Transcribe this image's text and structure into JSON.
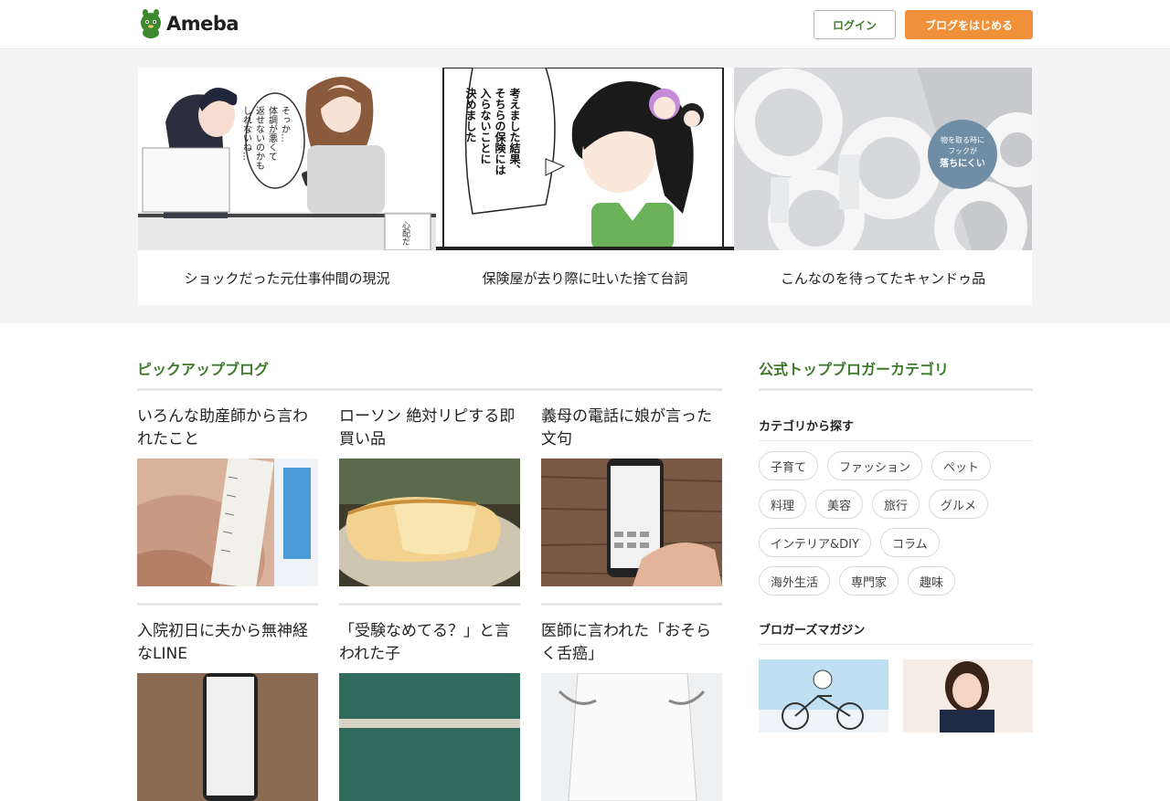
{
  "header": {
    "logo_text": "Ameba",
    "login_label": "ログイン",
    "start_label": "ブログをはじめる"
  },
  "featured": [
    {
      "title": "ショックだった元仕事仲間の現況"
    },
    {
      "title": "保険屋が去り際に吐いた捨て台詞"
    },
    {
      "title": "こんなのを待ってたキャンドゥ品"
    }
  ],
  "pickup": {
    "heading": "ピックアップブログ",
    "items": [
      {
        "title": "いろんな助産師から言われたこと"
      },
      {
        "title": "ローソン 絶対リピする即買い品"
      },
      {
        "title": "義母の電話に娘が言った文句"
      },
      {
        "title": "入院初日に夫から無神経なLINE"
      },
      {
        "title": "「受験なめてる？」と言われた子"
      },
      {
        "title": "医師に言われた「おそらく舌癌」"
      }
    ]
  },
  "sidebar": {
    "heading": "公式トップブロガーカテゴリ",
    "category_heading": "カテゴリから探す",
    "tag_rows": [
      [
        "子育て",
        "ファッション",
        "ペット"
      ],
      [
        "料理",
        "美容",
        "旅行",
        "グルメ"
      ],
      [
        "インテリア&DIY",
        "コラム"
      ],
      [
        "海外生活",
        "専門家",
        "趣味"
      ]
    ],
    "magazine_heading": "ブロガーズマガジン"
  },
  "manga_text": {
    "bubble1": "そっか…体調が悪くて返せないのかもしれないね…",
    "bubble2": "考えました結果、そちらの保険には入らないことに決めました",
    "side_text": "心配だ",
    "label_box": "物を取る時にフックが落ちにくい"
  },
  "colors": {
    "accent_green": "#3d7a2c",
    "accent_orange": "#f0913a",
    "band_bg": "#f3f4f3"
  }
}
